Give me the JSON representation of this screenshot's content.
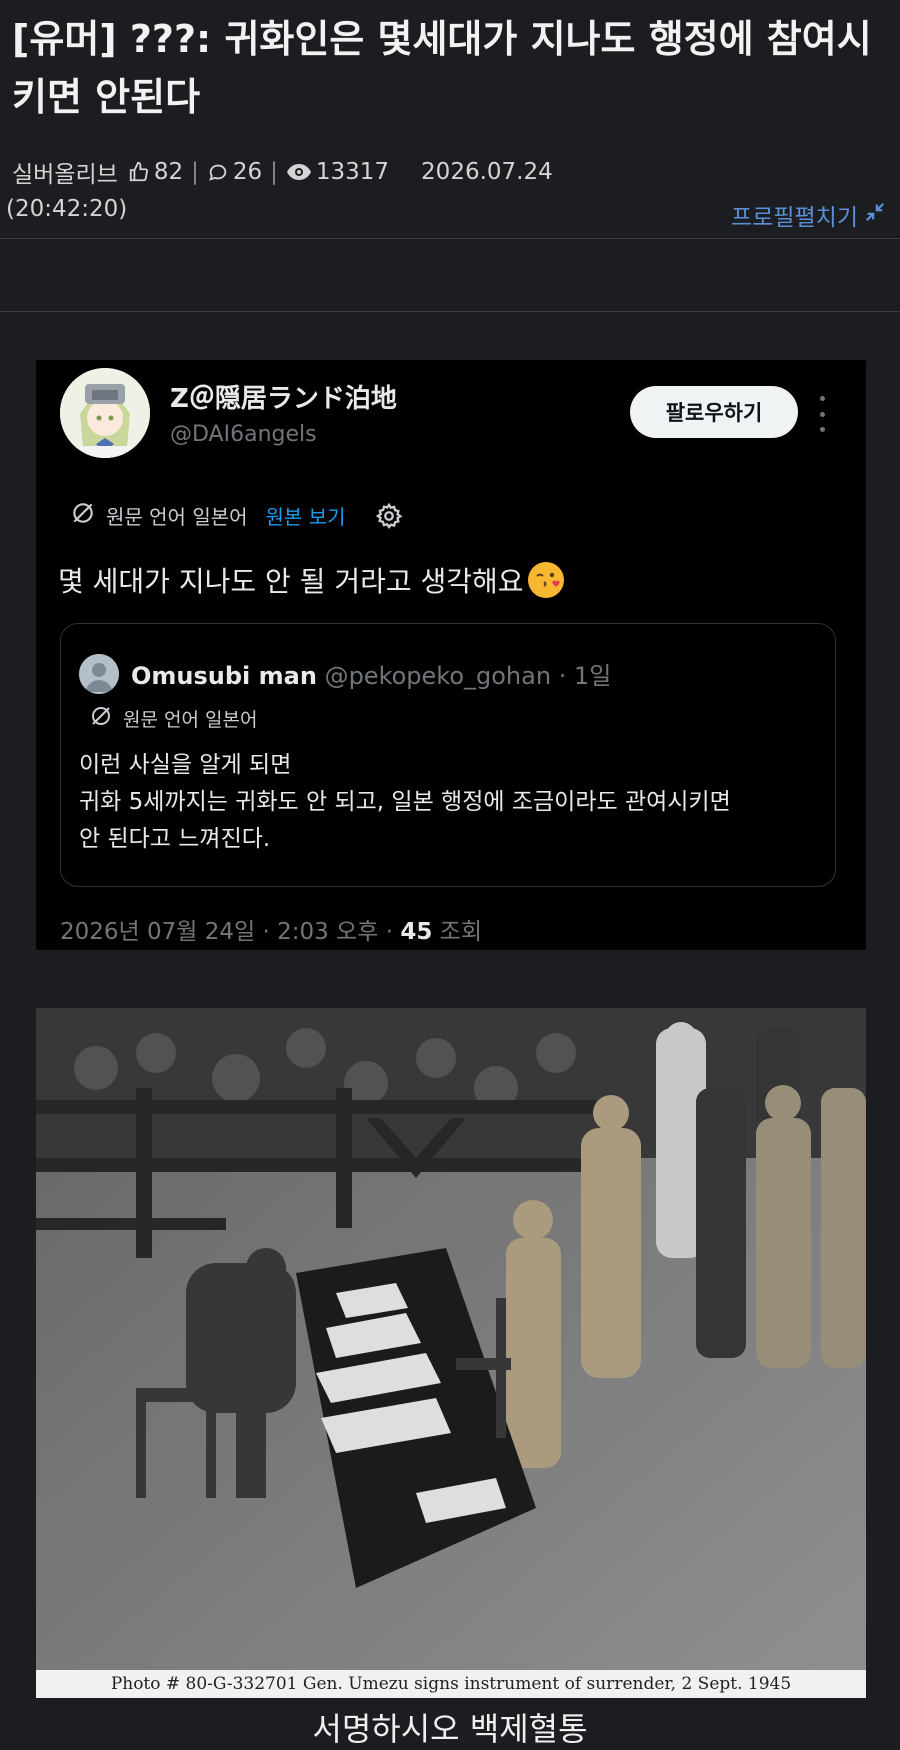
{
  "post": {
    "title": "[유머] ???: 귀화인은 몇세대가 지나도 행정에 참여시키면 안된다",
    "author": "실버올리브",
    "likes": "82",
    "comments": "26",
    "views": "13317",
    "date": "2026.07.24",
    "time": "(20:42:20)",
    "profile_toggle": "프로필펼치기"
  },
  "tweet": {
    "name": "Z＠隠居ランド泊地",
    "handle": "@DAI6angels",
    "follow_label": "팔로우하기",
    "lang_label": "원문 언어 일본어",
    "show_original": "원본 보기",
    "text": "몇 세대가 지나도 안 될 거라고 생각해요",
    "footer_prefix": "2026년 07월 24일 · 2:03 오후 · ",
    "footer_count": "45",
    "footer_suffix": " 조회",
    "quote": {
      "name": "Omusubi man",
      "handle": "@pekopeko_gohan",
      "age": " · 1일",
      "lang_label": "원문 언어 일본어",
      "line1": "이런 사실을 알게 되면",
      "line2": "귀화 5세까지는 귀화도 안 되고, 일본 행정에 조금이라도 관여시키면",
      "line3": "안 된다고 느껴진다."
    }
  },
  "photo": {
    "caption": "Photo #  80-G-332701  Gen. Umezu signs instrument of surrender, 2 Sept. 1945"
  },
  "bottom_caption": "서명하시오 백제혈통",
  "colors": {
    "background": "#1b1d21",
    "link_blue": "#1d9bf0",
    "profile_toggle_blue": "#5b8fd6",
    "tweet_bg": "#000000"
  }
}
